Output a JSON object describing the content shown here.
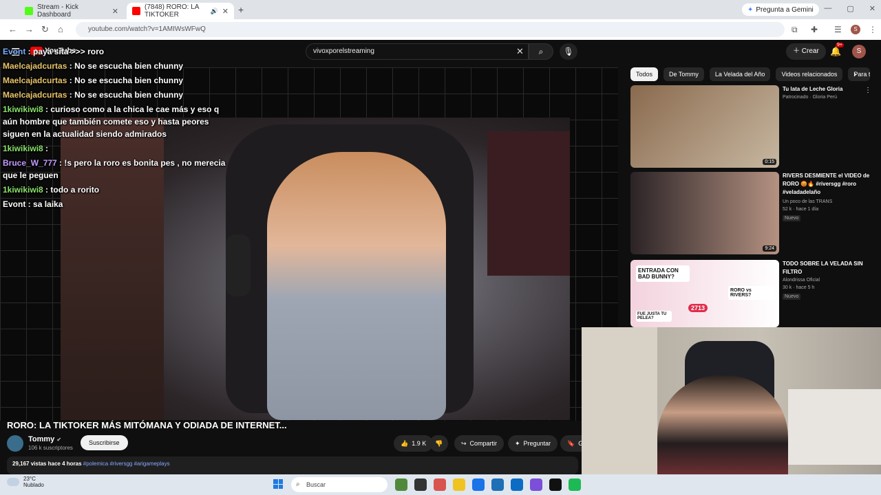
{
  "browser": {
    "tabs": [
      {
        "label": "Stream - Kick Dashboard",
        "favicon_color": "#53fc18"
      },
      {
        "label": "(7848) RORO: LA TIKTOKER",
        "favicon_color": "#ff0000"
      }
    ],
    "new_tab": "+",
    "gemini_button": "Pregunta a Gemini",
    "url": "youtube.com/watch?v=1AMIWsWFwQ",
    "window_controls": [
      "—",
      "▢",
      "✕"
    ]
  },
  "youtube": {
    "logo_text": "YouTube",
    "search_value": "vivoxporelstreaming",
    "create_label": "Crear",
    "notifications_badge": "9+",
    "avatar_letter": "S"
  },
  "chat": [
    {
      "user": "Evont",
      "text": "paya sita >>> roro",
      "color": "#7ab0ff"
    },
    {
      "user": "Maelcajadcurtas",
      "text": "No se escucha bien chunny",
      "color": "#e8c36a"
    },
    {
      "user": "Maelcajadcurtas",
      "text": "No se escucha bien chunny",
      "color": "#e8c36a"
    },
    {
      "user": "Maelcajadcurtas",
      "text": "No se escucha bien chunny",
      "color": "#e8c36a"
    },
    {
      "user": "1kiwikiwi8",
      "text": "curioso como a la chica le cae más y eso q aún hombre que también comete eso y hasta peores siguen en la actualidad siendo admirados",
      "color": "#8be36a"
    },
    {
      "user": "1kiwikiwi8",
      "text": "",
      "color": "#8be36a"
    },
    {
      "user": "Bruce_W_777",
      "text": "!s pero la roro es bonita pes , no merecia que le peguen",
      "color": "#c59bff"
    },
    {
      "user": "1kiwikiwi8",
      "text": "todo a rorito",
      "color": "#8be36a"
    },
    {
      "user": "Evont",
      "text": "sa laika",
      "color": "#ffffff"
    }
  ],
  "video": {
    "title": "RORO: LA TIKTOKER MÁS MITÓMANA Y ODIADA DE INTERNET...",
    "channel": "Tommy",
    "subscribers": "106 k suscriptores",
    "subscribe_label": "Suscribirse",
    "likes": "1.9 K",
    "share_label": "Compartir",
    "ask_label": "Preguntar",
    "save_label": "Gu",
    "views": "29,167 vistas",
    "age": "hace 4 horas",
    "tags": "#polemica #riversgg #arigameplays"
  },
  "sidebar": {
    "chips": [
      "Todos",
      "De Tommy",
      "La Velada del Año",
      "Videos relacionados",
      "Para ti"
    ],
    "recommendations": [
      {
        "title": "Tu lata de Leche Gloria",
        "channel": "Patrocinado · Gloria Perú",
        "meta": "",
        "badge": "",
        "duration": "0:15",
        "thumb_colors": [
          "#8a6a4e",
          "#c7b7a1"
        ]
      },
      {
        "title": "RIVERS DESMIENTE el VIDEO de RORO 😡🔥 #riversgg #roro #veladadelaño",
        "channel": "Un poco de las TRANS",
        "meta": "52 k · hace 1 día",
        "badge": "Nuevo",
        "duration": "9:24",
        "thumb_colors": [
          "#2b2326",
          "#b59282"
        ]
      },
      {
        "title": "TODO SOBRE LA VELADA SIN FILTRO",
        "channel": "Alondrissa Oficial",
        "meta": "30 k · hace 5 h",
        "badge": "Nuevo",
        "duration": "",
        "thumb_colors": [
          "#f3d2de",
          "#ffffff"
        ],
        "thumb_texts": [
          "ENTRADA CON BAD BUNNY?",
          "RORO vs RIVERS?",
          "FUE JUSTA TU PELEA?",
          "2713"
        ]
      }
    ]
  },
  "taskbar": {
    "temperature": "23°C",
    "weather": "Nublado",
    "search_label": "Buscar",
    "apps": [
      "#4f8a3c",
      "#333333",
      "#d9534f",
      "#f0c420",
      "#1a73e8",
      "#1e6fb5",
      "#0c6cc4",
      "#7b4fd8",
      "#111111",
      "#1db954"
    ]
  }
}
